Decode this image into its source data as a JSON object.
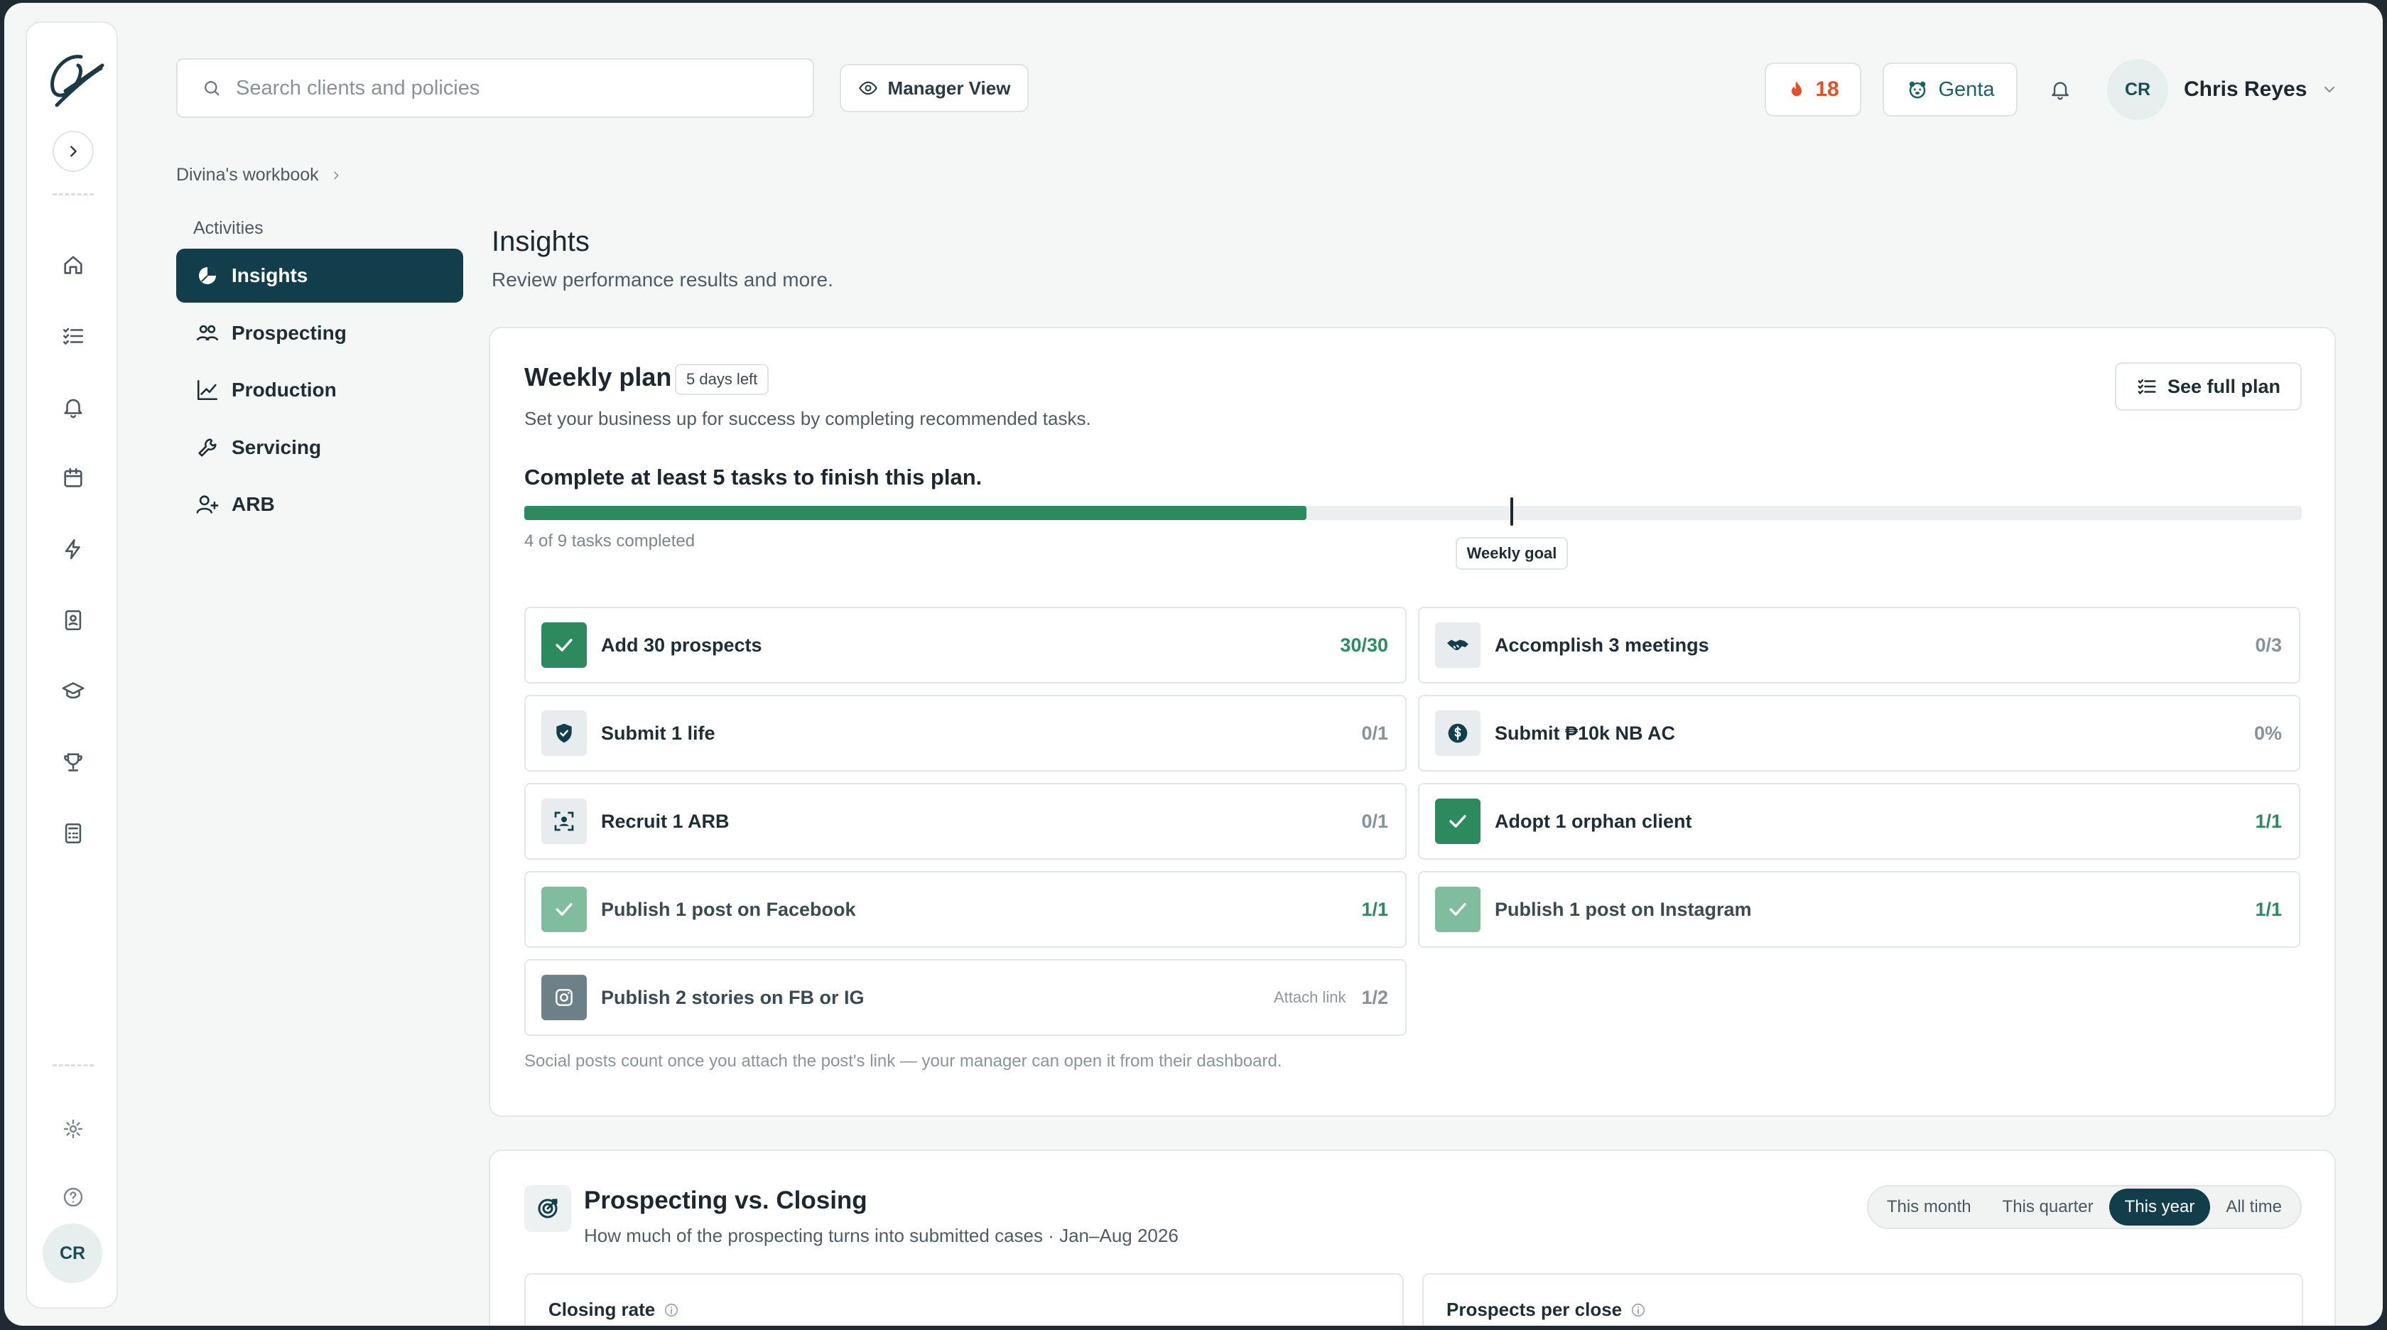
{
  "rail": {
    "avatar": "CR"
  },
  "header": {
    "search_placeholder": "Search clients and policies",
    "manager_view": "Manager View",
    "streak_count": "18",
    "assistant_name": "Genta",
    "user_initials": "CR",
    "user_name": "Chris Reyes"
  },
  "breadcrumb": {
    "workbook": "Divina's workbook"
  },
  "sidenav": {
    "section": "Activities",
    "items": [
      {
        "label": "Insights"
      },
      {
        "label": "Prospecting"
      },
      {
        "label": "Production"
      },
      {
        "label": "Servicing"
      },
      {
        "label": "ARB"
      }
    ]
  },
  "page": {
    "title": "Insights",
    "subtitle": "Review performance results and more."
  },
  "weekly_plan": {
    "title": "Weekly plan",
    "badge": "5 days left",
    "subtitle": "Set your business up for success by completing recommended tasks.",
    "see_full_plan": "See full plan",
    "goal_heading": "Complete at least 5 tasks to finish this plan.",
    "progress_fraction": 0.44,
    "weekly_goal_fraction": 0.5556,
    "progress_caption": "4 of 9 tasks completed",
    "goal_label": "Weekly goal",
    "tasks": [
      {
        "label": "Add 30 prospects",
        "value": "30/30"
      },
      {
        "label": "Accomplish 3 meetings",
        "value": "0/3"
      },
      {
        "label": "Submit 1 life",
        "value": "0/1"
      },
      {
        "label": "Submit ₱10k NB AC",
        "value": "0%"
      },
      {
        "label": "Recruit 1 ARB",
        "value": "0/1"
      },
      {
        "label": "Adopt 1 orphan client",
        "value": "1/1"
      },
      {
        "label": "Publish 1 post on Facebook",
        "value": "1/1"
      },
      {
        "label": "Publish 1 post on Instagram",
        "value": "1/1"
      },
      {
        "label": "Publish 2 stories on FB or IG",
        "value": "1/2",
        "action": "Attach link"
      }
    ],
    "footnote": "Social posts count once you attach the post's link — your manager can open it from their dashboard."
  },
  "prospecting_closing": {
    "title": "Prospecting vs. Closing",
    "subtitle": "How much of the prospecting turns into submitted cases · Jan–Aug 2026",
    "ranges": [
      "This month",
      "This quarter",
      "This year",
      "All time"
    ],
    "selected_range": "This year",
    "cards": [
      {
        "title": "Closing rate"
      },
      {
        "title": "Prospects per close"
      }
    ]
  },
  "colors": {
    "primary": "#123d4b",
    "success": "#2d8a5f",
    "streak": "#e0502a"
  }
}
